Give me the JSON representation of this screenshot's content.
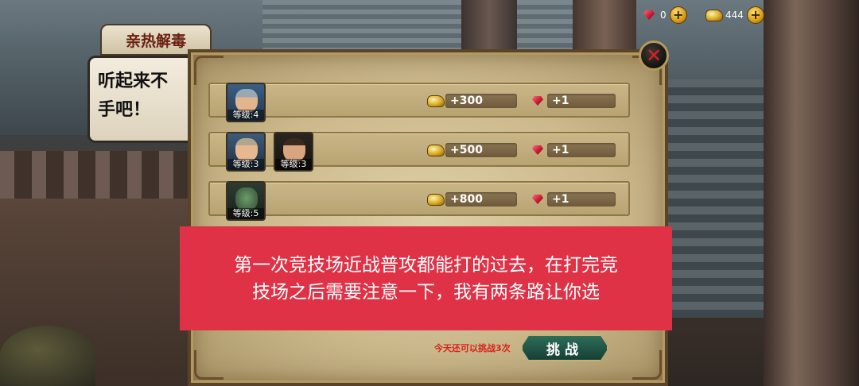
{
  "resources": {
    "gems": "0",
    "gold": "444"
  },
  "npc": {
    "name": "亲热解毒",
    "dialog_line1": "听起来不",
    "dialog_line2": "手吧！"
  },
  "opponents": [
    {
      "avatars": [
        {
          "icon": "knight-portrait",
          "level": "等级:4"
        }
      ],
      "gold": "+300",
      "gems": "+1"
    },
    {
      "avatars": [
        {
          "icon": "viking-portrait",
          "level": "等级:3"
        },
        {
          "icon": "warrior-portrait",
          "level": "等级:3"
        }
      ],
      "gold": "+500",
      "gems": "+1"
    },
    {
      "avatars": [
        {
          "icon": "orc-portrait",
          "level": "等级:5"
        }
      ],
      "gold": "+800",
      "gems": "+1"
    }
  ],
  "tip": {
    "line1": "第一次竞技场近战普攻都能打的过去，在打完竞",
    "line2": "技场之后需要注意一下，我有两条路让你选"
  },
  "footer": {
    "attempts_text": "今天还可以挑战3次",
    "challenge_label": "挑战"
  },
  "colors": {
    "tip_bg": "#e03246",
    "panel_bg": "#cbb98c",
    "challenge_btn": "#2d6e59",
    "attempts_text": "#d8201c"
  }
}
